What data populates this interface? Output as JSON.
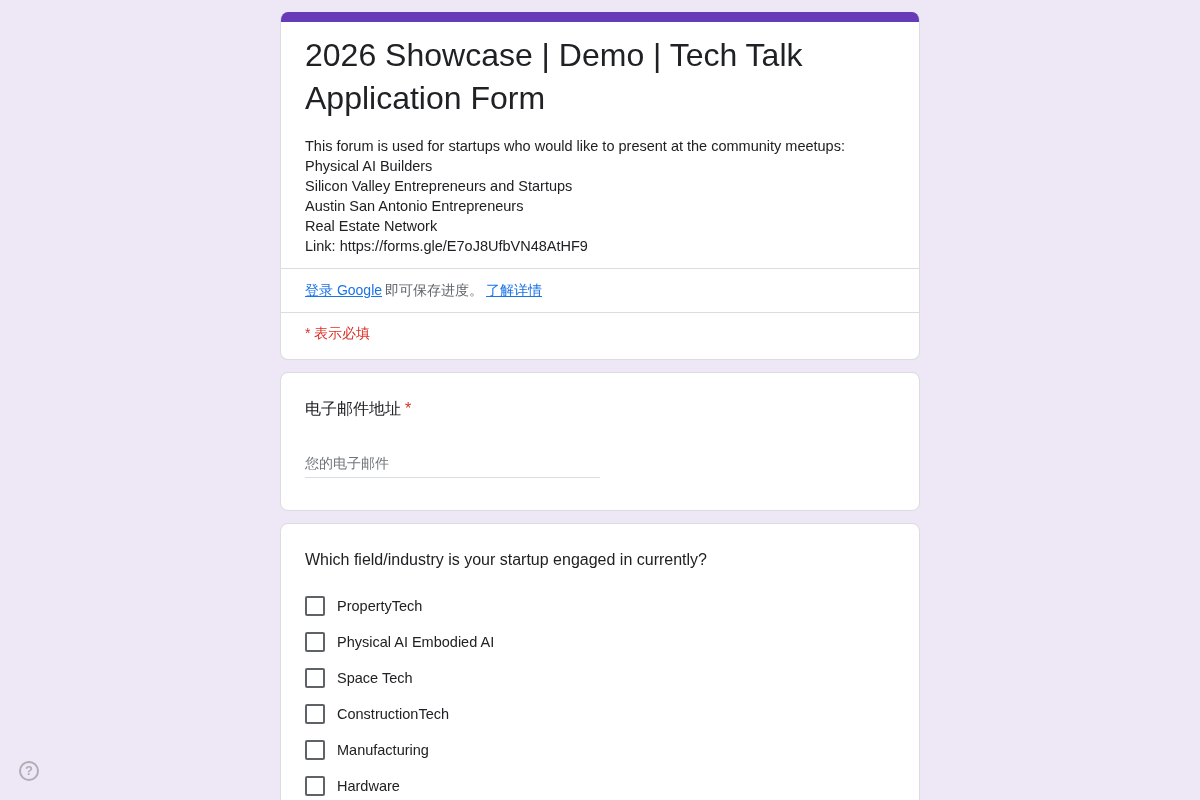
{
  "header": {
    "title": "2026 Showcase | Demo | Tech Talk Application Form",
    "description": [
      "This forum is used for startups who would like to present at the community meetups:",
      "Physical AI Builders",
      "Silicon Valley Entrepreneurs and Startups",
      "Austin San Antonio Entrepreneurs",
      "Real Estate Network",
      "Link: https://forms.gle/E7oJ8UfbVN48AtHF9"
    ],
    "signin": {
      "link": "登录 Google",
      "text": "即可保存进度。",
      "learn_more": "了解详情"
    },
    "required_note": "* 表示必填"
  },
  "questions": [
    {
      "kind": "text",
      "title": "电子邮件地址",
      "required_mark": "*",
      "placeholder": "您的电子邮件"
    },
    {
      "kind": "checkbox",
      "title": "Which field/industry is your startup engaged in currently?",
      "options": [
        {
          "label": "PropertyTech",
          "checked": false
        },
        {
          "label": "Physical AI Embodied AI",
          "checked": false
        },
        {
          "label": "Space Tech",
          "checked": false
        },
        {
          "label": "ConstructionTech",
          "checked": false
        },
        {
          "label": "Manufacturing",
          "checked": false
        },
        {
          "label": "Hardware",
          "checked": false
        }
      ]
    }
  ],
  "help": "?"
}
